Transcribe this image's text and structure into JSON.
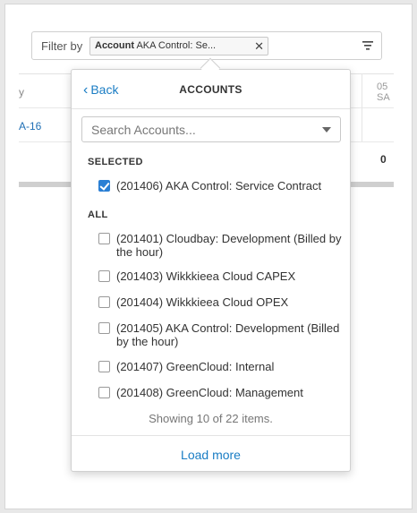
{
  "filter": {
    "label": "Filter by",
    "chip": {
      "key": "Account",
      "value": "AKA Control: Se..."
    },
    "icons": {
      "chip_close": "close-icon",
      "filter": "filter-icon"
    }
  },
  "background_table": {
    "col_head_fragment": "y",
    "date_top": "05",
    "date_bottom": "SA",
    "row_link": "A-16",
    "total_value": "0"
  },
  "dropdown": {
    "back_label": "Back",
    "title": "ACCOUNTS",
    "search": {
      "placeholder": "Search Accounts...",
      "value": ""
    },
    "selected_label": "SELECTED",
    "selected": [
      {
        "label": "(201406) AKA Control: Service Contract",
        "checked": true
      }
    ],
    "all_label": "ALL",
    "all": [
      {
        "label": "(201401) Cloudbay: Development (Billed by the hour)",
        "checked": false
      },
      {
        "label": "(201403) Wikkkieea Cloud CAPEX",
        "checked": false
      },
      {
        "label": "(201404) Wikkkieea Cloud OPEX",
        "checked": false
      },
      {
        "label": "(201405) AKA Control: Development (Billed by the hour)",
        "checked": false
      },
      {
        "label": "(201407) GreenCloud: Internal",
        "checked": false
      },
      {
        "label": "(201408) GreenCloud: Management",
        "checked": false
      }
    ],
    "showing_text": "Showing 10 of 22 items.",
    "load_more_label": "Load more"
  },
  "colors": {
    "accent": "#1a7dc4",
    "checkbox_checked": "#2a7fd4"
  }
}
